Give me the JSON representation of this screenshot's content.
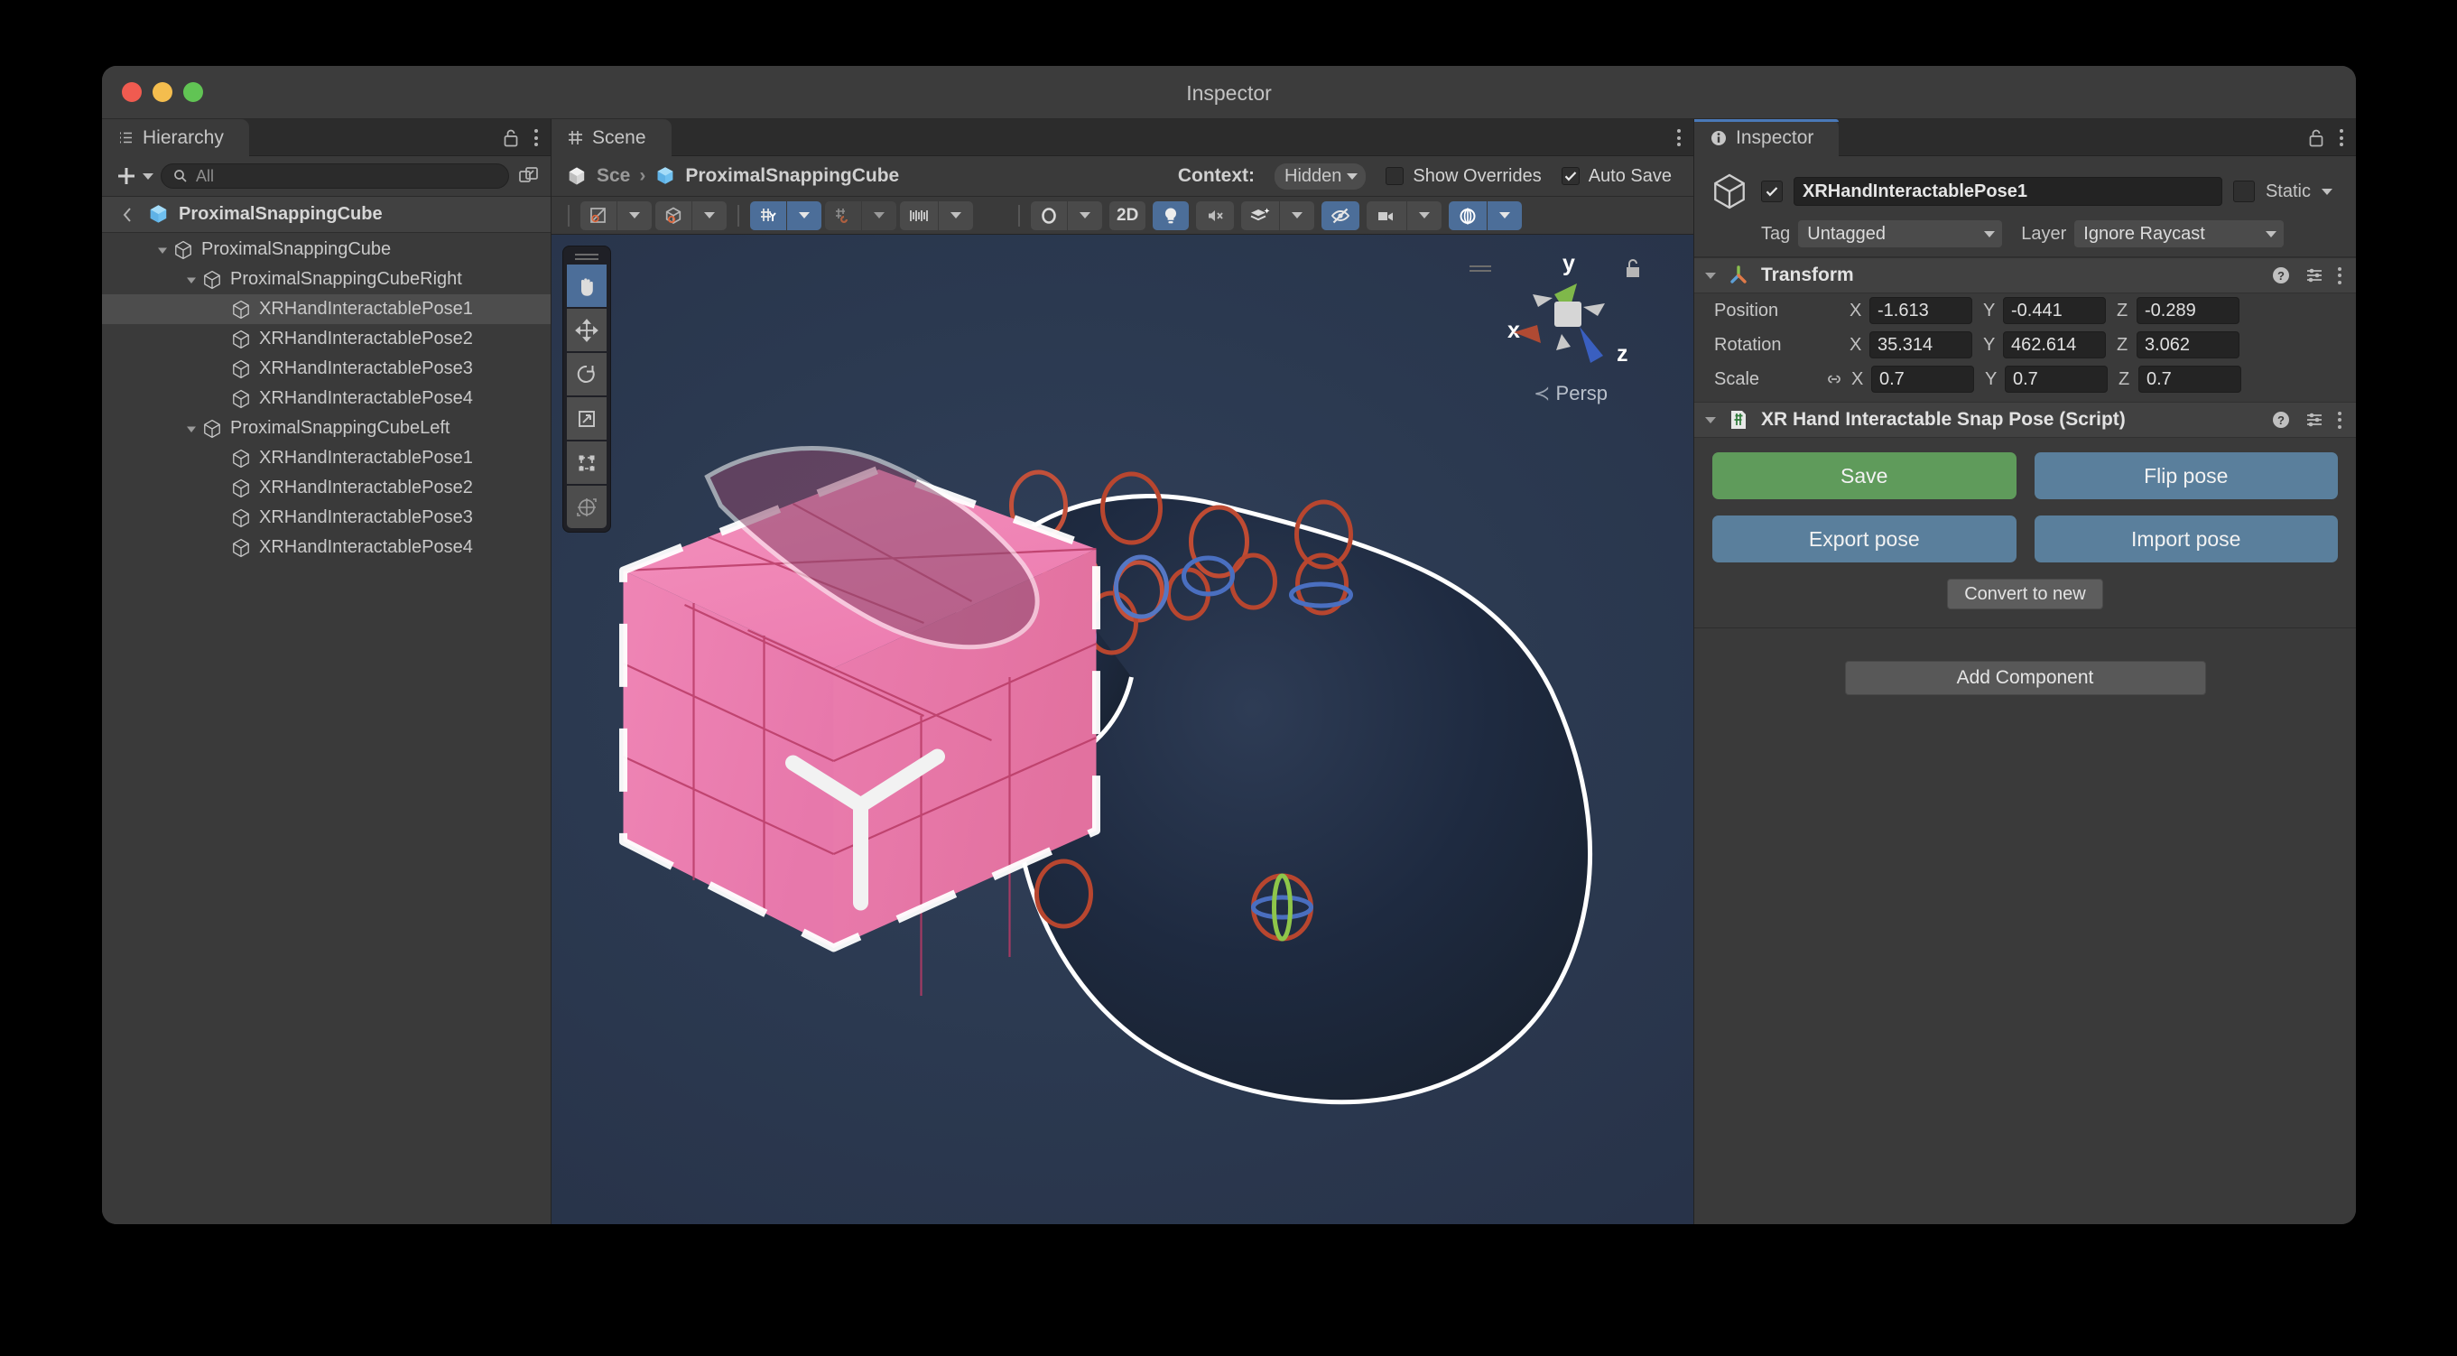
{
  "window": {
    "title": "Inspector"
  },
  "hierarchy": {
    "tab_label": "Hierarchy",
    "search_placeholder": "All",
    "breadcrumb": "ProximalSnappingCube",
    "items": [
      {
        "label": "ProximalSnappingCube",
        "depth": 1,
        "expanded": true,
        "selected": false
      },
      {
        "label": "ProximalSnappingCubeRight",
        "depth": 2,
        "expanded": true,
        "selected": false
      },
      {
        "label": "XRHandInteractablePose1",
        "depth": 3,
        "expanded": false,
        "selected": true
      },
      {
        "label": "XRHandInteractablePose2",
        "depth": 3,
        "expanded": false,
        "selected": false
      },
      {
        "label": "XRHandInteractablePose3",
        "depth": 3,
        "expanded": false,
        "selected": false
      },
      {
        "label": "XRHandInteractablePose4",
        "depth": 3,
        "expanded": false,
        "selected": false
      },
      {
        "label": "ProximalSnappingCubeLeft",
        "depth": 2,
        "expanded": true,
        "selected": false
      },
      {
        "label": "XRHandInteractablePose1",
        "depth": 3,
        "expanded": false,
        "selected": false
      },
      {
        "label": "XRHandInteractablePose2",
        "depth": 3,
        "expanded": false,
        "selected": false
      },
      {
        "label": "XRHandInteractablePose3",
        "depth": 3,
        "expanded": false,
        "selected": false
      },
      {
        "label": "XRHandInteractablePose4",
        "depth": 3,
        "expanded": false,
        "selected": false
      }
    ]
  },
  "scene": {
    "tab_label": "Scene",
    "breadcrumb_root": "Sce",
    "breadcrumb_current": "ProximalSnappingCube",
    "context_label": "Context:",
    "context_value": "Hidden",
    "show_overrides_label": "Show Overrides",
    "show_overrides_checked": false,
    "auto_save_label": "Auto Save",
    "auto_save_checked": true,
    "toolbar": {
      "toggle_2d": "2D"
    },
    "gizmo": {
      "axis_x": "x",
      "axis_y": "y",
      "axis_z": "z",
      "projection": "Persp"
    },
    "tools": [
      "hand-tool",
      "move-tool",
      "rotate-tool",
      "scale-tool",
      "rect-tool",
      "transform-tool"
    ],
    "active_tool": "hand-tool",
    "background_color": "#2b3950",
    "cube_color": "#ef7fb2",
    "outline_color": "#ffffff"
  },
  "inspector": {
    "tab_label": "Inspector",
    "object_name": "XRHandInteractablePose1",
    "object_enabled": true,
    "static_label": "Static",
    "static_checked": false,
    "tag_label": "Tag",
    "tag_value": "Untagged",
    "layer_label": "Layer",
    "layer_value": "Ignore Raycast",
    "transform": {
      "title": "Transform",
      "rows": [
        {
          "label": "Position",
          "x": "-1.613",
          "y": "-0.441",
          "z": "-0.289",
          "linked": false
        },
        {
          "label": "Rotation",
          "x": "35.314",
          "y": "462.614",
          "z": "3.062",
          "linked": false
        },
        {
          "label": "Scale",
          "x": "0.7",
          "y": "0.7",
          "z": "0.7",
          "linked": true
        }
      ],
      "axis_x": "X",
      "axis_y": "Y",
      "axis_z": "Z"
    },
    "script": {
      "title": "XR Hand Interactable Snap Pose (Script)",
      "save_label": "Save",
      "flip_label": "Flip pose",
      "export_label": "Export pose",
      "import_label": "Import pose",
      "convert_label": "Convert to new",
      "save_color": "#5f9b5b",
      "action_color": "#5a7f9c"
    },
    "add_component_label": "Add Component"
  }
}
